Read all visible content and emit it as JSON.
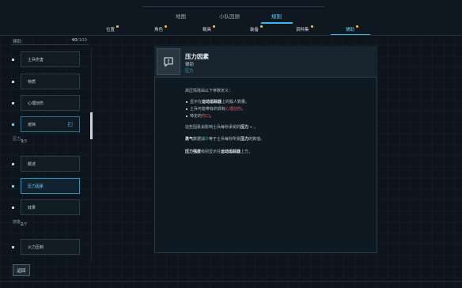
{
  "nav": {
    "main_tabs": [
      "地图",
      "小队回顾",
      "规则"
    ],
    "sub_tabs": [
      "位置",
      "角色",
      "载具",
      "装备",
      "资料集",
      "辅助"
    ]
  },
  "sidebar": {
    "header": "辅助",
    "count": "40",
    "count_total": "/103",
    "items": [
      {
        "label": "士兵伤害"
      },
      {
        "label": "特质"
      },
      {
        "label": "心理创伤"
      },
      {
        "label": "遮挡"
      },
      {
        "label": "概述"
      },
      {
        "label": "压力因素"
      },
      {
        "label": "效果"
      },
      {
        "label": "火力压制"
      }
    ],
    "cat_pressure": {
      "label": "压力",
      "count": "3",
      "total": "/3"
    },
    "cat_skills": {
      "label": "技能",
      "count": "2",
      "total": "/7"
    }
  },
  "detail": {
    "title": "压力因素",
    "category": "辅助",
    "subcategory": "压力",
    "intro": "高压情境由以下参数定义：",
    "bullets": [
      {
        "a": "显示在",
        "b": "运动追踪器",
        "c": "上的敌人数量。"
      },
      {
        "a": "士兵可能带有的现有",
        "b": "心理创伤",
        "c": "。"
      },
      {
        "a": "特定的",
        "b": "伤口",
        "c": "。"
      }
    ],
    "p1": {
      "a": "这些因素会影响士兵每秒承受的",
      "b": "压力",
      "c": "。"
    },
    "p2": {
      "a": "勇气",
      "b": "数据",
      "c": "减少",
      "d": "等于士兵每秒所受",
      "e": "压力",
      "f": "的数值。"
    },
    "p3": {
      "a": "压力强度",
      "b": "级别显示在",
      "c": "运动追踪器",
      "d": "上方。"
    }
  },
  "footer": {
    "back_label": "返回"
  },
  "colors": {
    "accent": "#5fd2ff",
    "green": "#5fe08a",
    "red": "#e85c5c",
    "badge": "#e6b34a"
  }
}
